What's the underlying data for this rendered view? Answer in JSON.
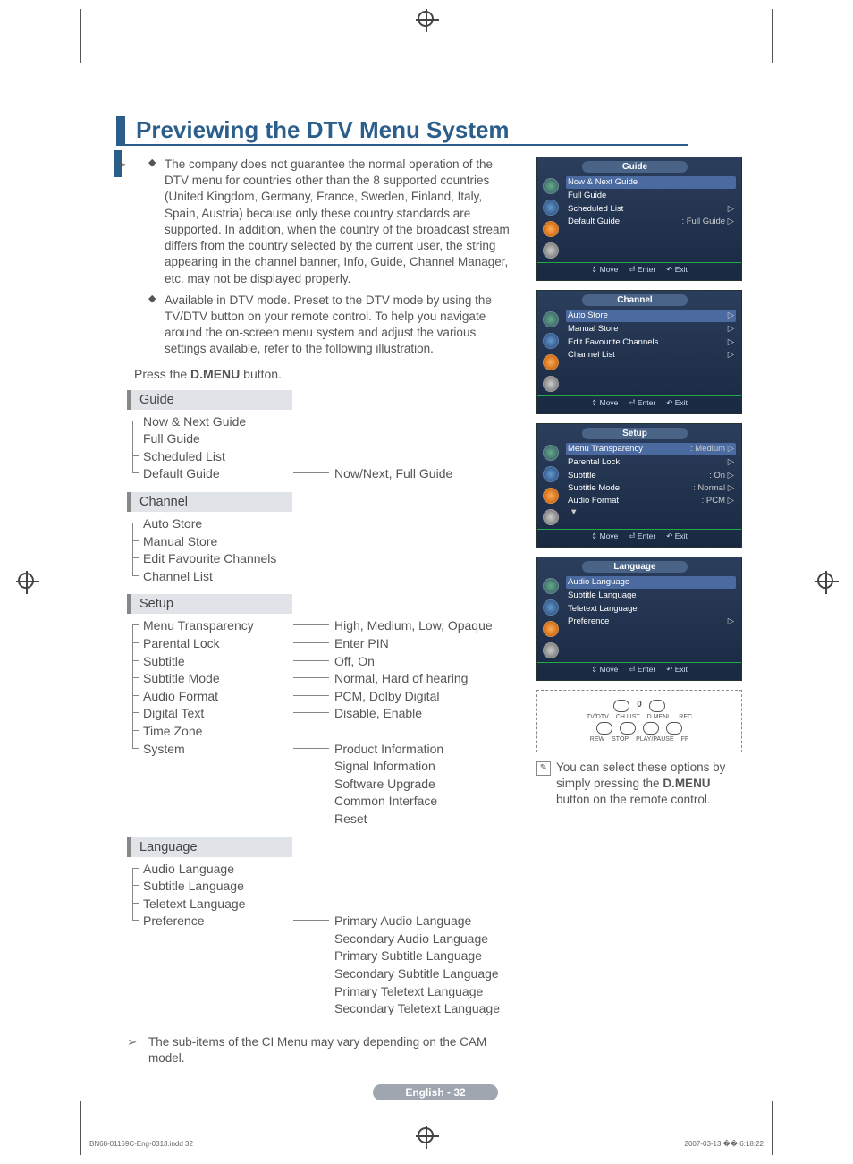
{
  "title": "Previewing the DTV Menu System",
  "intro": {
    "bullet1": "The company does not guarantee the normal operation of the DTV menu for countries other than the 8 supported countries (United Kingdom, Germany, France, Sweden, Finland, Italy, Spain, Austria) because only these country standards are supported. In addition, when the country of the broadcast stream differs from the country selected by the current user, the string appearing in the channel banner, Info, Guide, Channel Manager, etc. may not be displayed properly.",
    "bullet2": "Available in DTV mode. Preset to the DTV mode by using the TV/DTV button on your remote control. To help you navigate around the on-screen menu system and adjust the various settings available, refer to the following illustration."
  },
  "press_prefix": "Press the ",
  "press_bold": "D.MENU",
  "press_suffix": " button.",
  "sections": [
    {
      "head": "Guide",
      "items": [
        {
          "label": "Now & Next Guide",
          "val": ""
        },
        {
          "label": "Full Guide",
          "val": ""
        },
        {
          "label": "Scheduled List",
          "val": ""
        },
        {
          "label": "Default Guide",
          "val": "Now/Next, Full Guide",
          "conn": true
        }
      ]
    },
    {
      "head": "Channel",
      "items": [
        {
          "label": "Auto Store",
          "val": ""
        },
        {
          "label": "Manual Store",
          "val": ""
        },
        {
          "label": "Edit Favourite Channels",
          "val": ""
        },
        {
          "label": "Channel List",
          "val": ""
        }
      ]
    },
    {
      "head": "Setup",
      "items": [
        {
          "label": "Menu Transparency",
          "val": "High, Medium, Low, Opaque",
          "conn": true
        },
        {
          "label": "Parental Lock",
          "val": "Enter PIN",
          "conn": true
        },
        {
          "label": "Subtitle",
          "val": "Off, On",
          "conn": true
        },
        {
          "label": "Subtitle Mode",
          "val": "Normal, Hard of hearing",
          "conn": true
        },
        {
          "label": "Audio Format",
          "val": "PCM, Dolby Digital",
          "conn": true
        },
        {
          "label": "Digital Text",
          "val": "Disable, Enable",
          "conn": true
        },
        {
          "label": "Time Zone",
          "val": ""
        },
        {
          "label": "System",
          "val": "Product Information\nSignal Information\nSoftware Upgrade\nCommon Interface\nReset",
          "conn": true
        }
      ]
    },
    {
      "head": "Language",
      "items": [
        {
          "label": "Audio Language",
          "val": ""
        },
        {
          "label": "Subtitle Language",
          "val": ""
        },
        {
          "label": "Teletext Language",
          "val": ""
        },
        {
          "label": "Preference",
          "val": "Primary Audio Language\nSecondary Audio Language\nPrimary Subtitle Language\nSecondary Subtitle Language\nPrimary Teletext Language\nSecondary Teletext Language",
          "conn": true
        }
      ]
    }
  ],
  "osd_footer": {
    "move": "Move",
    "enter": "Enter",
    "exit": "Exit"
  },
  "osd_panels": [
    {
      "title": "Guide",
      "rows": [
        {
          "l": "Now & Next Guide",
          "r": "",
          "hl": true
        },
        {
          "l": "Full Guide",
          "r": ""
        },
        {
          "l": "Scheduled List",
          "r": "▷"
        },
        {
          "l": "Default Guide",
          "r": ": Full Guide   ▷"
        }
      ]
    },
    {
      "title": "Channel",
      "rows": [
        {
          "l": "Auto Store",
          "r": "▷",
          "hl": true
        },
        {
          "l": "Manual Store",
          "r": "▷"
        },
        {
          "l": "Edit Favourite Channels",
          "r": "▷"
        },
        {
          "l": "Channel List",
          "r": "▷"
        }
      ]
    },
    {
      "title": "Setup",
      "rows": [
        {
          "l": "Menu Transparency",
          "r": ": Medium   ▷",
          "hl": true
        },
        {
          "l": "Parental Lock",
          "r": "▷"
        },
        {
          "l": "Subtitle",
          "r": ": On          ▷"
        },
        {
          "l": "Subtitle  Mode",
          "r": ": Normal   ▷"
        },
        {
          "l": "Audio Format",
          "r": ": PCM       ▷"
        }
      ],
      "more": "▼"
    },
    {
      "title": "Language",
      "rows": [
        {
          "l": "Audio Language",
          "r": "",
          "hl": true
        },
        {
          "l": "Subtitle Language",
          "r": ""
        },
        {
          "l": "Teletext Language",
          "r": ""
        },
        {
          "l": "Preference",
          "r": "▷"
        }
      ]
    }
  ],
  "remote": {
    "zero": "0",
    "row1": [
      "TV/DTV",
      "CH LIST",
      "D.MENU",
      "REC"
    ],
    "row2": [
      "REW",
      "STOP",
      "PLAY/PAUSE",
      "FF"
    ]
  },
  "note_text1": "You can select these options by simply pressing the ",
  "note_bold": "D.MENU",
  "note_text2": " button on the remote control.",
  "sub_note": "The sub-items of the CI Menu may vary depending on the CAM model.",
  "page_footer": "English - 32",
  "meta_left": "BN68-01169C-Eng-0313.indd   32",
  "meta_right": "2007-03-13   �� 6:18:22"
}
